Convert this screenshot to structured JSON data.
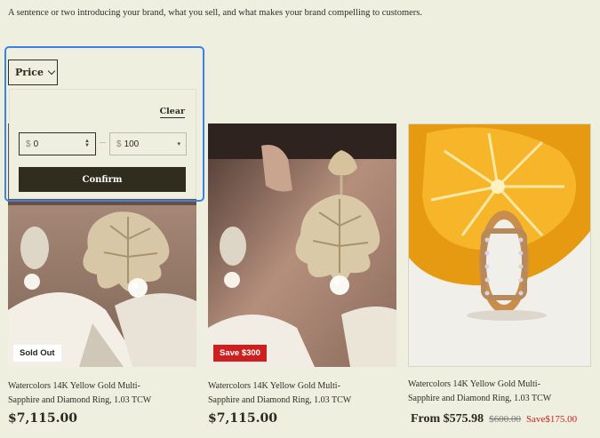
{
  "intro_text": "A sentence or two introducing your brand, what you sell, and what makes your brand compelling to customers.",
  "filter": {
    "toggle_label": "Price",
    "clear_label": "Clear",
    "min": {
      "currency": "$",
      "value": "0"
    },
    "max": {
      "currency": "$",
      "value": "100"
    },
    "confirm_label": "Confirm",
    "focus_color": "#3b82e6"
  },
  "products": [
    {
      "badge": "Sold Out",
      "title_line1": "Watercolors 14K Yellow Gold Multi-",
      "title_line2": "Sapphire and Diamond Ring, 1.03 TCW",
      "price": "$7,115.00"
    },
    {
      "badge": "Save $300",
      "title_line1": "Watercolors 14K Yellow Gold Multi-",
      "title_line2": "Sapphire and Diamond Ring, 1.03 TCW",
      "price": "$7,115.00"
    },
    {
      "title_line1": "Watercolors 14K Yellow Gold Multi-",
      "title_line2": "Sapphire and Diamond Ring, 1.03 TCW",
      "price_from": "From $575.98",
      "price_original": "$600.00",
      "price_saving": "Save$175.00"
    }
  ],
  "colors": {
    "background": "#efefdf",
    "sale": "#cc1f1f",
    "button": "#302d1f"
  }
}
